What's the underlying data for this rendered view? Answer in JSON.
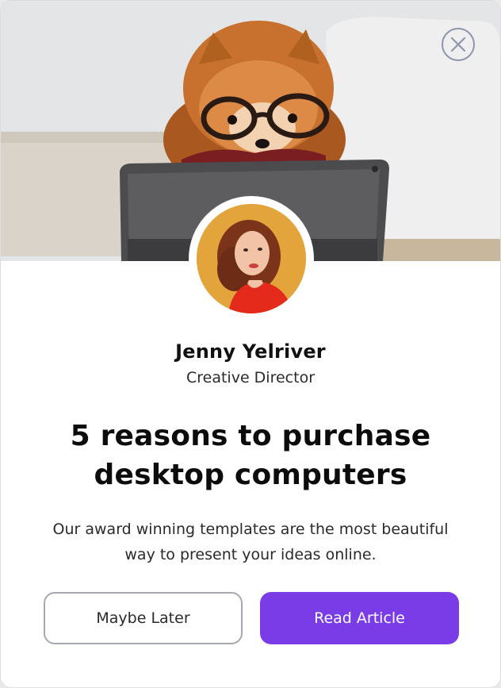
{
  "author": {
    "name": "Jenny Yelriver",
    "role": "Creative Director"
  },
  "article": {
    "headline": "5 reasons to purchase desktop computers",
    "description": "Our award winning templates are the most beautiful way to present your ideas online."
  },
  "actions": {
    "secondary_label": "Maybe Later",
    "primary_label": "Read Article"
  },
  "icons": {
    "close": "close-icon",
    "hero": "dog-with-tablet-image",
    "avatar": "author-avatar-image"
  },
  "colors": {
    "primary": "#7a3ce6",
    "secondary_border": "#a6a9b1",
    "text": "#111111"
  }
}
